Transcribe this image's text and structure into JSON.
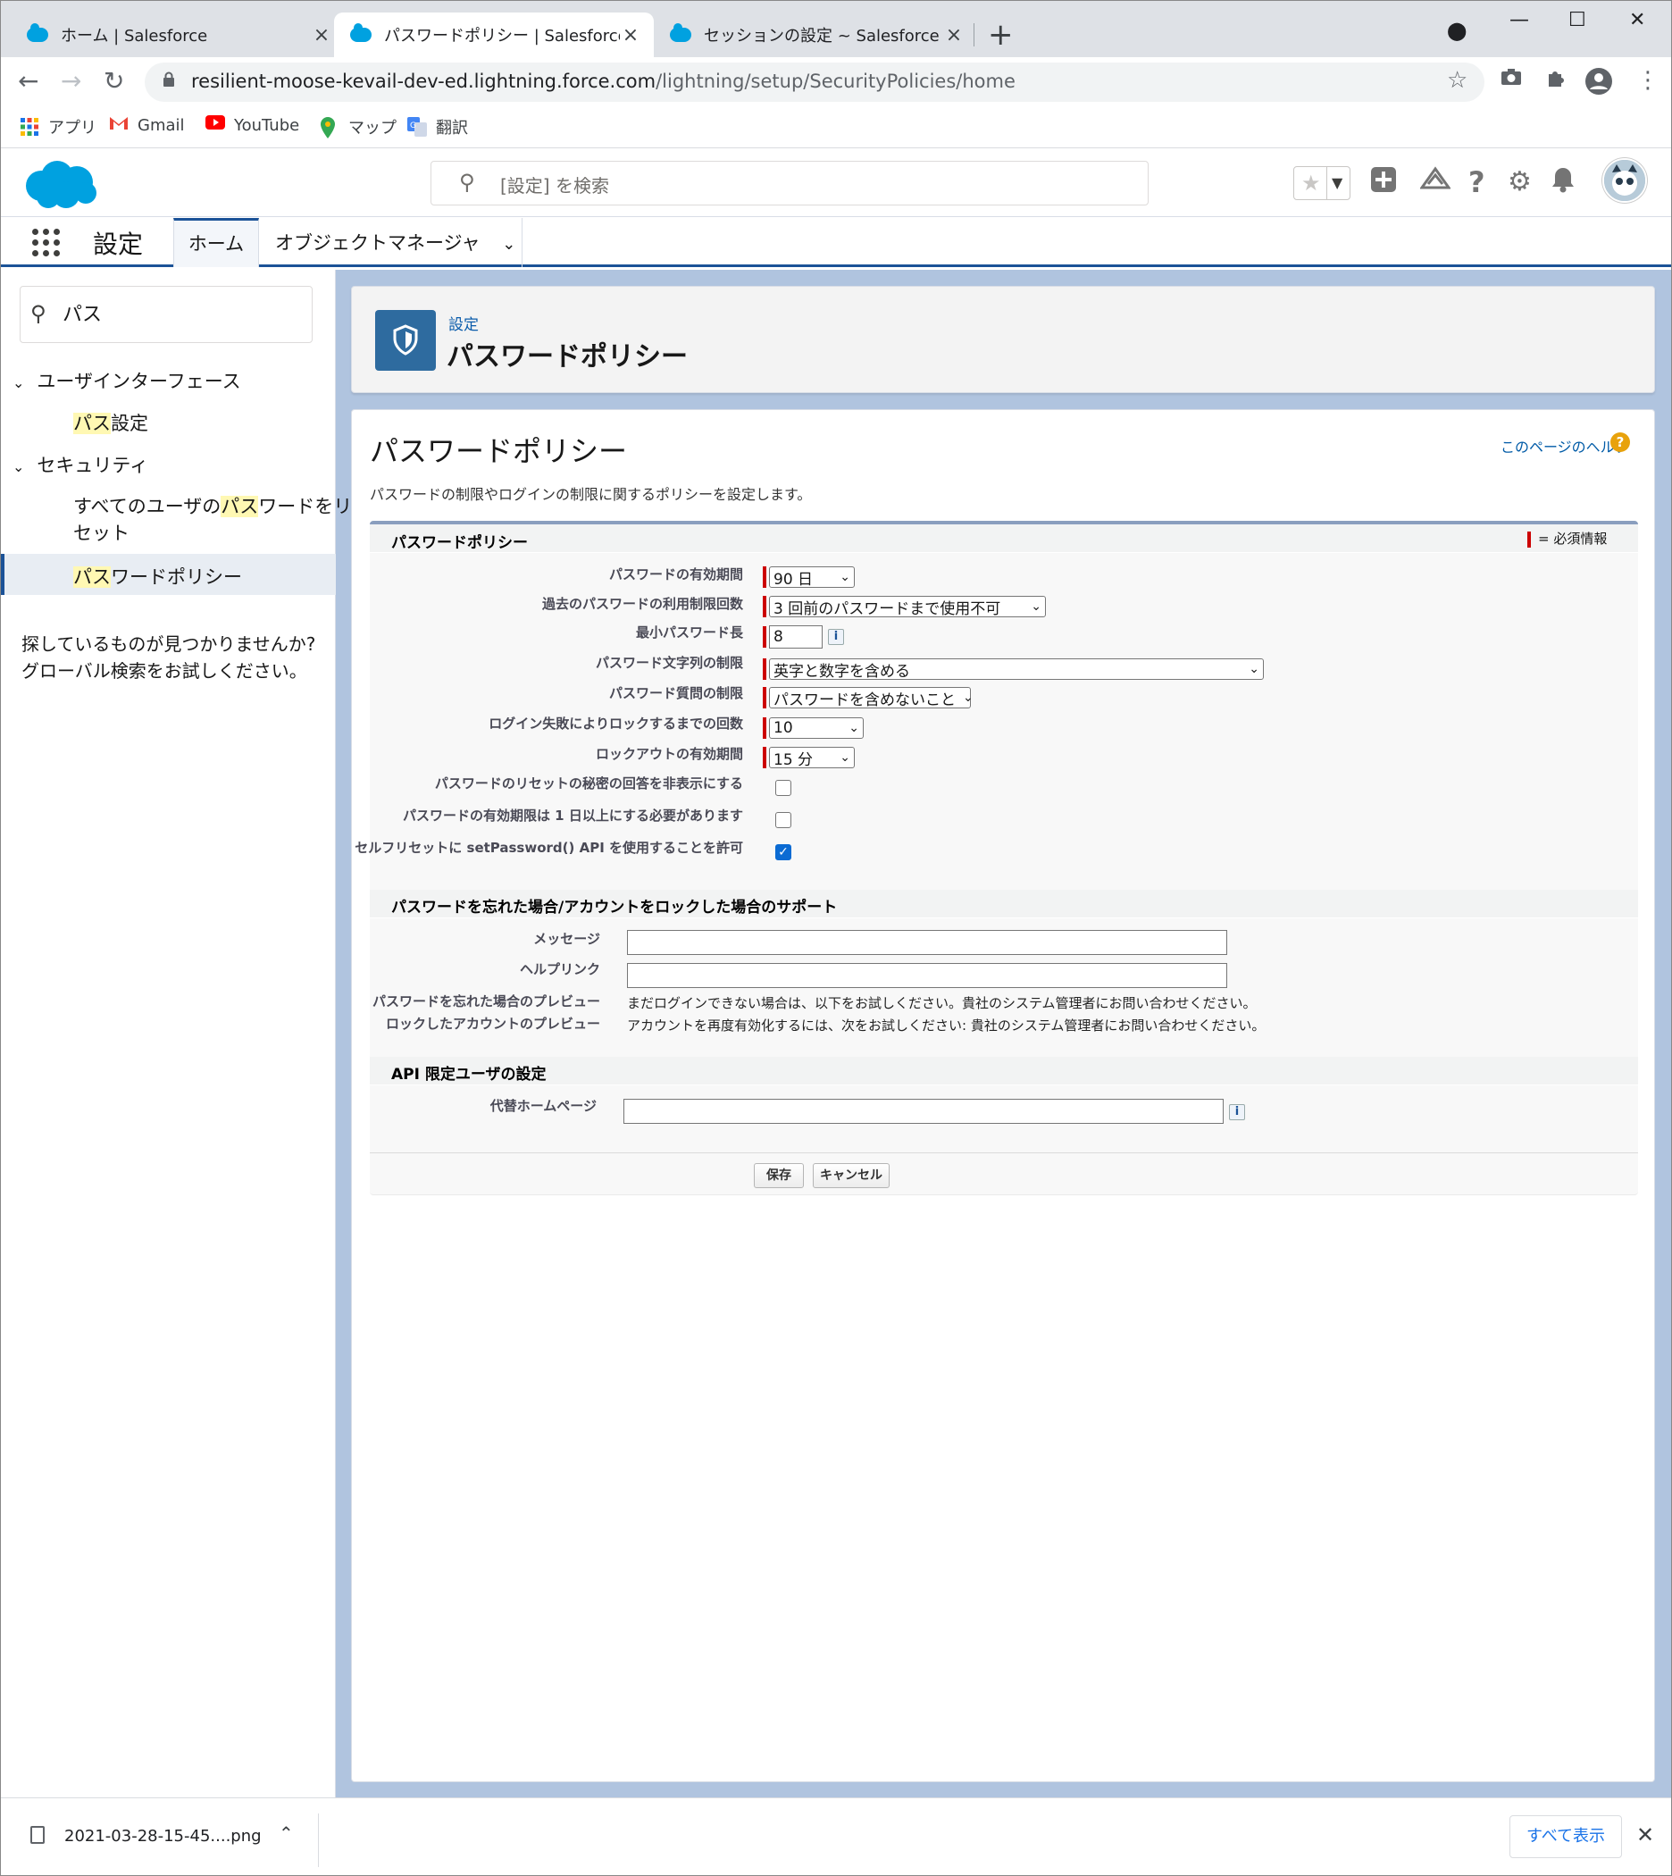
{
  "browser": {
    "tabs": [
      {
        "title": "ホーム | Salesforce",
        "active": false
      },
      {
        "title": "パスワードポリシー | Salesforce",
        "active": true
      },
      {
        "title": "セッションの設定 ~ Salesforce - Dev",
        "active": false
      }
    ],
    "url_host": "resilient-moose-kevail-dev-ed.lightning.force.com",
    "url_path": "/lightning/setup/SecurityPolicies/home",
    "bookmarks": [
      "アプリ",
      "Gmail",
      "YouTube",
      "マップ",
      "翻訳"
    ]
  },
  "sf_header": {
    "search_placeholder": "[設定] を検索"
  },
  "nav": {
    "app_name": "設定",
    "home_tab": "ホーム",
    "object_manager": "オブジェクトマネージャ"
  },
  "sidebar": {
    "quickfind_value": "パス",
    "groups": [
      {
        "label": "ユーザインターフェース",
        "items": [
          {
            "hl": "パス",
            "rest": "設定",
            "rest2": ""
          }
        ]
      },
      {
        "label": "セキュリティ",
        "items": [
          {
            "pre": "すべてのユーザの",
            "hl": "パス",
            "rest": "ワードをリ",
            "rest2": "セット"
          },
          {
            "hl": "パス",
            "rest": "ワードポリシー",
            "rest2": ""
          }
        ]
      }
    ],
    "not_found_line1": "探しているものが見つかりませんか?",
    "not_found_line2": "グローバル検索をお試しください。"
  },
  "page_header": {
    "breadcrumb": "設定",
    "title": "パスワードポリシー"
  },
  "content": {
    "title": "パスワードポリシー",
    "help_link": "このページのヘルプ",
    "description": "パスワードの制限やログインの制限に関するポリシーを設定します。",
    "section1": {
      "title": "パスワードポリシー",
      "required_legend": "= 必須情報",
      "fields": {
        "expiry_label": "パスワードの有効期間",
        "expiry_value": "90 日",
        "history_label": "過去のパスワードの利用制限回数",
        "history_value": "3 回前のパスワードまで使用不可",
        "minlen_label": "最小パスワード長",
        "minlen_value": "8",
        "complexity_label": "パスワード文字列の制限",
        "complexity_value": "英字と数字を含める",
        "question_label": "パスワード質問の制限",
        "question_value": "パスワードを含めないこと",
        "lockout_attempts_label": "ログイン失敗によりロックするまでの回数",
        "lockout_attempts_value": "10",
        "lockout_period_label": "ロックアウトの有効期間",
        "lockout_period_value": "15 分",
        "hide_answer_label": "パスワードのリセットの秘密の回答を非表示にする",
        "min_one_day_label": "パスワードの有効期限は 1 日以上にする必要があります",
        "setpassword_label": "セルフリセットに setPassword() API を使用することを許可"
      },
      "checkboxes": {
        "hide_answer": false,
        "min_one_day": false,
        "setpassword": true
      }
    },
    "section2": {
      "title": "パスワードを忘れた場合/アカウントをロックした場合のサポート",
      "message_label": "メッセージ",
      "message_value": "",
      "helplink_label": "ヘルプリンク",
      "helplink_value": "",
      "forgot_preview_label": "パスワードを忘れた場合のプレビュー",
      "forgot_preview_text": "まだログインできない場合は、以下をお試しください。貴社のシステム管理者にお問い合わせください。",
      "locked_preview_label": "ロックしたアカウントのプレビュー",
      "locked_preview_text": "アカウントを再度有効化するには、次をお試しください: 貴社のシステム管理者にお問い合わせください。"
    },
    "section3": {
      "title": "API 限定ユーザの設定",
      "alt_home_label": "代替ホームページ",
      "alt_home_value": ""
    },
    "buttons": {
      "save": "保存",
      "cancel": "キャンセル"
    }
  },
  "downloads": {
    "file": "2021-03-28-15-45....png",
    "show_all": "すべて表示"
  },
  "colors": {
    "sf_blue": "#00a1e0",
    "nav_accent": "#1b5297",
    "required": "#cc0000",
    "link": "#015ba7"
  }
}
